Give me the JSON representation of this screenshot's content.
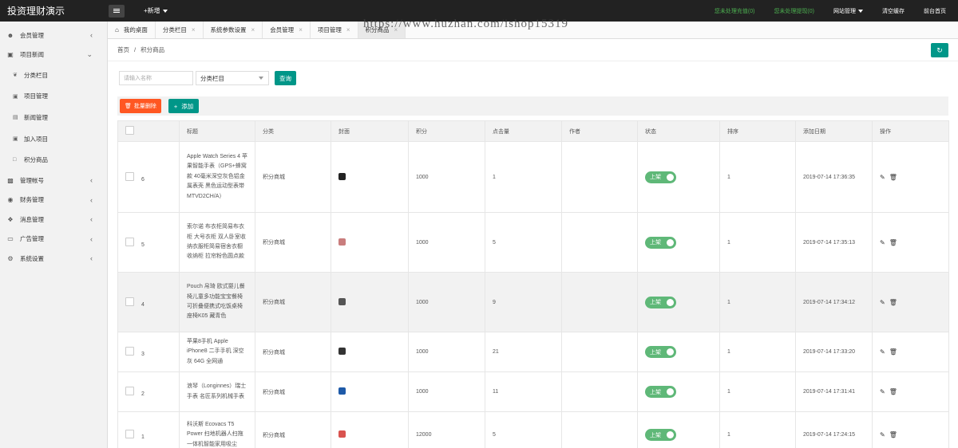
{
  "app": {
    "title": "投资理财演示"
  },
  "topbar": {
    "new_label": "+新增",
    "links": [
      "您未处理充值(0)",
      "您未处理提现(0)"
    ],
    "site_manage": "网站管理",
    "clear_cache": "清空缓存",
    "frontend_home": "前台首页"
  },
  "watermark": "https://www.huzhan.com/ishop15319",
  "sidebar": {
    "items": [
      {
        "label": "会员管理",
        "icon": "user-icon",
        "expanded": false
      },
      {
        "label": "项目新闻",
        "icon": "briefcase-icon",
        "expanded": true
      },
      {
        "label": "管理帐号",
        "icon": "id-card-icon",
        "expanded": false
      },
      {
        "label": "财务管理",
        "icon": "coin-icon",
        "expanded": false
      },
      {
        "label": "消息管理",
        "icon": "message-icon",
        "expanded": false
      },
      {
        "label": "广告管理",
        "icon": "ad-icon",
        "expanded": false
      },
      {
        "label": "系统设置",
        "icon": "gear-icon",
        "expanded": false
      }
    ],
    "subitems": [
      {
        "label": "分类栏目",
        "icon": "leaf-icon"
      },
      {
        "label": "项目管理",
        "icon": "cart-icon"
      },
      {
        "label": "新闻管理",
        "icon": "doc-icon"
      },
      {
        "label": "加入项目",
        "icon": "cart-icon"
      },
      {
        "label": "积分商品",
        "icon": "gift-icon"
      }
    ]
  },
  "tabs": [
    {
      "label": "我的桌面",
      "closable": false
    },
    {
      "label": "分类栏目",
      "closable": true
    },
    {
      "label": "系统参数设置",
      "closable": true
    },
    {
      "label": "会员管理",
      "closable": true
    },
    {
      "label": "项目管理",
      "closable": true
    },
    {
      "label": "积分商品",
      "closable": true,
      "active": true
    }
  ],
  "breadcrumb": {
    "home": "首页",
    "separator": "/",
    "current": "积分商品"
  },
  "filters": {
    "name_placeholder": "请输入名称",
    "category_value": "分类栏目",
    "query_label": "查询"
  },
  "toolbar": {
    "batch_delete": "批量删除",
    "add": "添加"
  },
  "table": {
    "columns": [
      "",
      "标题",
      "分类",
      "封面",
      "积分",
      "点击量",
      "作者",
      "状态",
      "排序",
      "添加日期",
      "操作"
    ],
    "rows": [
      {
        "id": "6",
        "title": "Apple Watch Series 4 苹果智能手表（GPS+蜂窝款 40毫米深空灰色铝金属表壳 黑色运动型表带 MTVD2CH/A）",
        "category": "积分商城",
        "cover_color": "#222222",
        "points": "1000",
        "clicks": "1",
        "author": "",
        "status": "上架",
        "sort": "1",
        "date": "2019-07-14 17:36:35"
      },
      {
        "id": "5",
        "title": "索尔诺 布衣柜简易布衣柜 大号衣柜 双人卧室收纳衣服柜简易宿舍衣橱收纳柜 拉帘粉色圆点款",
        "category": "积分商城",
        "cover_color": "#c97d7d",
        "points": "1000",
        "clicks": "5",
        "author": "",
        "status": "上架",
        "sort": "1",
        "date": "2019-07-14 17:35:13"
      },
      {
        "id": "4",
        "title": "Pouch 帛琦 欧式婴儿餐椅儿童多功能宝宝餐椅可折叠便携式吃饭桌椅座椅K05 藏青色",
        "category": "积分商城",
        "cover_color": "#555555",
        "points": "1000",
        "clicks": "9",
        "author": "",
        "status": "上架",
        "sort": "1",
        "date": "2019-07-14 17:34:12"
      },
      {
        "id": "3",
        "title": "苹果8手机 Apple iPhone8 二手手机 深空灰 64G 全网通",
        "category": "积分商城",
        "cover_color": "#333333",
        "points": "1000",
        "clicks": "21",
        "author": "",
        "status": "上架",
        "sort": "1",
        "date": "2019-07-14 17:33:20"
      },
      {
        "id": "2",
        "title": "浪琴（Longinnes）瑞士手表 名匠系列机械手表",
        "category": "积分商城",
        "cover_color": "#1e5aa8",
        "points": "1000",
        "clicks": "11",
        "author": "",
        "status": "上架",
        "sort": "1",
        "date": "2019-07-14 17:31:41"
      },
      {
        "id": "1",
        "title": "科沃斯 Ecovacs T5 Power 扫地机器人扫拖一体机智能家用吸尘",
        "category": "积分商城",
        "cover_color": "#d9534f",
        "points": "12000",
        "clicks": "5",
        "author": "",
        "status": "上架",
        "sort": "1",
        "date": "2019-07-14 17:24:15"
      }
    ]
  }
}
